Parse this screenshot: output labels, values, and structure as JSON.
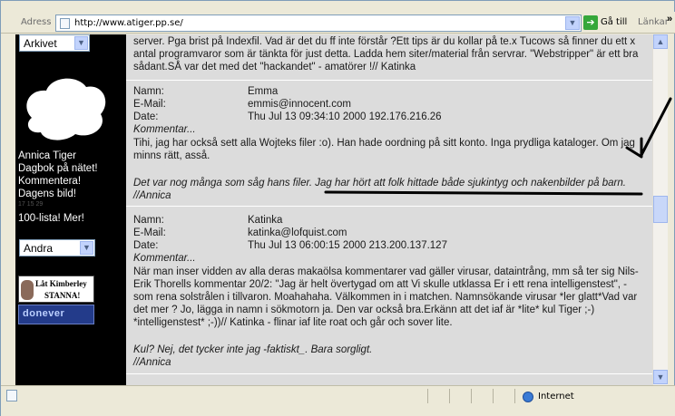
{
  "browser": {
    "address_label": "Adress",
    "url": "http://www.atiger.pp.se/",
    "go_label": "Gå till",
    "links_label": "Länkar",
    "links_chevron": "»",
    "status_zone": "Internet"
  },
  "sidebar": {
    "archive_select": "Arkivet",
    "links": [
      "Annica Tiger",
      "Dagbok på nätet!",
      "Kommentera!",
      "Dagens bild!"
    ],
    "tiny_text": "17   15   29",
    "top_list": "100-lista! Mer!",
    "other_select": "Andra",
    "banner_kimberley_line1": "Låt Kimberley",
    "banner_kimberley_line2": "STANNA!",
    "banner_2": "donever"
  },
  "content": {
    "prev_text": "server. Pga brist på Indexfil. Vad är det du ff inte förstår ?Ett tips är du kollar på te.x Tucows så finner du ett x antal programvaror som är tänkta för just detta. Ladda hem siter/material från servrar. \"Webstripper\" är ett bra sådant.SÅ var det med det \"hackandet\" - amatörer !// Katinka",
    "field_labels": {
      "name": "Namn:",
      "email": "E-Mail:",
      "date": "Date:"
    },
    "comment_label": "Kommentar...",
    "entries": [
      {
        "name": "Emma",
        "email": "emmis@innocent.com",
        "date": "Thu Jul 13 09:34:10 2000 192.176.216.26",
        "comment": "Tihi, jag har också sett alla Wojteks filer :o). Han hade oordning på sitt konto. Inga prydliga kataloger. Om jag minns rätt, asså.",
        "reply_line1": "Det var nog många som såg hans filer. Jag har hört att folk hittade både sjukintyg och nakenbilder på barn.",
        "reply_line2": "//Annica"
      },
      {
        "name": "Katinka",
        "email": "katinka@lofquist.com",
        "date": "Thu Jul 13 06:00:15 2000 213.200.137.127",
        "comment": "När man inser vidden av alla deras makaölsa kommentarer vad gäller virusar, dataintrång, mm så ter sig Nils-Erik Thorells kommentar 20/2: \"Jag är helt övertygad om att Vi skulle utklassa Er i ett rena intelligenstest\", - som rena solstrålen i tillvaron. Moahahaha. Välkommen in i matchen. Namnsökande virusar *ler glatt*Vad var det mer ? Jo, lägga in namn i sökmotorn ja. Den var också bra.Erkänn att det iaf är *lite* kul Tiger ;-) *intelligenstest* ;-))// Katinka - flinar iaf lite roat och går och sover lite.",
        "reply_line1": "Kul? Nej, det tycker inte jag -faktiskt_. Bara sorgligt.",
        "reply_line2": "//Annica"
      }
    ]
  },
  "colors": {
    "content_bg": "#dcdcdc",
    "sidebar_bg": "#000000",
    "annotation": "#000000"
  }
}
